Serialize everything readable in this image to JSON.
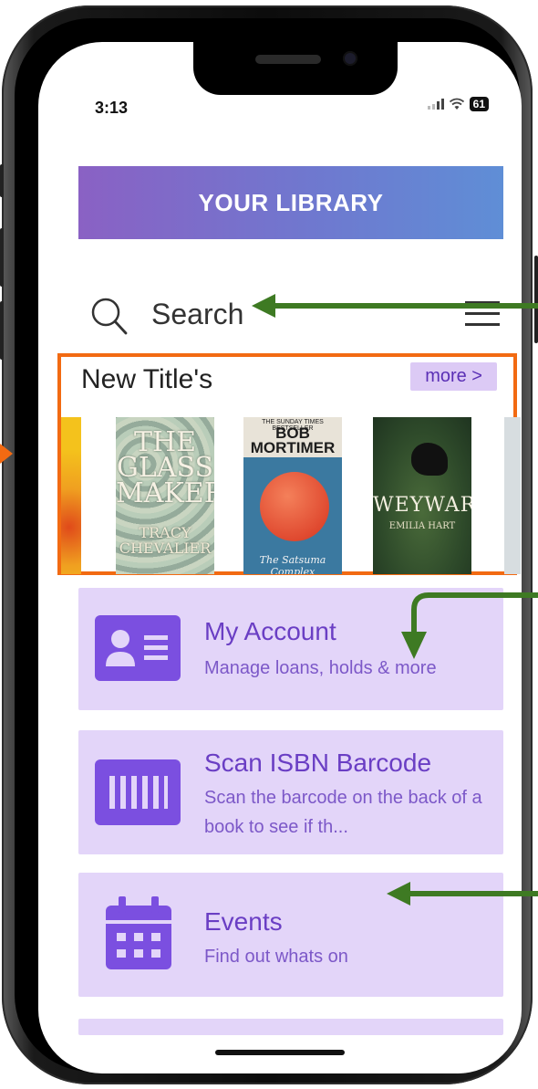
{
  "status_bar": {
    "time": "3:13",
    "battery": "61"
  },
  "header": {
    "title": "YOUR LIBRARY"
  },
  "search": {
    "label": "Search"
  },
  "new_titles": {
    "heading": "New Title's",
    "more_label": "more >",
    "books": [
      {
        "title": "THE GLASS MAKER",
        "author": "TRACY CHEVALIER"
      },
      {
        "tag": "THE SUNDAY TIMES BESTSELLER",
        "author": "BOB MORTIMER",
        "title": "The Satsuma Complex"
      },
      {
        "title": "WEYWARD",
        "author": "EMILIA HART"
      }
    ]
  },
  "menu": [
    {
      "title": "My Account",
      "subtitle": "Manage loans, holds & more"
    },
    {
      "title": "Scan ISBN Barcode",
      "subtitle": "Scan the barcode on the back of a book to see if th..."
    },
    {
      "title": "Events",
      "subtitle": "Find out whats on"
    }
  ],
  "colors": {
    "accent": "#7b4fe0",
    "card_bg": "#e3d5f9",
    "highlight_border": "#f26a12",
    "annotation_arrow": "#3e7a23"
  }
}
